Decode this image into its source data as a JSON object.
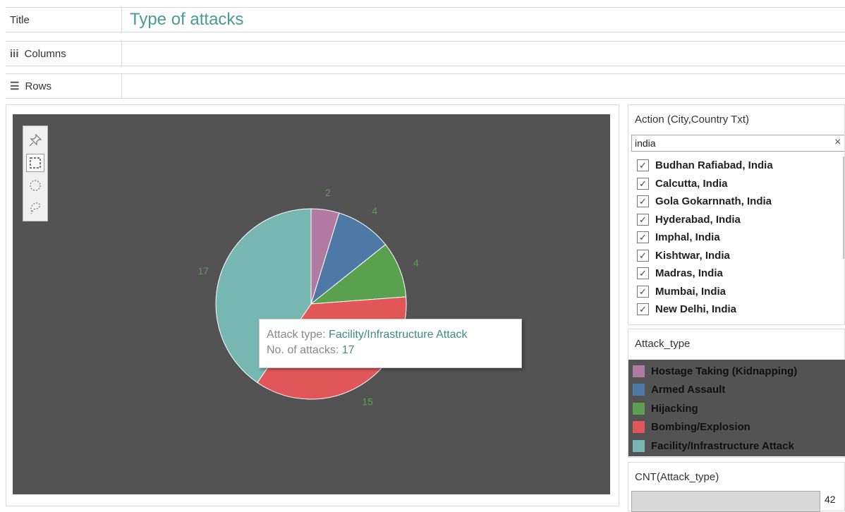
{
  "shelves": {
    "title_label": "Title",
    "title_value": "Type of attacks",
    "columns_label": "Columns",
    "rows_label": "Rows"
  },
  "tooltip": {
    "line1_label": "Attack type:",
    "line1_value": "Facility/Infrastructure Attack",
    "line2_label": "No. of attacks:",
    "line2_value": "17"
  },
  "action_filter": {
    "title": "Action (City,Country Txt)",
    "search_value": "india",
    "clear_symbol": "×",
    "items": [
      {
        "label": "Budhan Rafiabad, India",
        "checked": true
      },
      {
        "label": "Calcutta, India",
        "checked": true
      },
      {
        "label": "Gola Gokarnnath, India",
        "checked": true
      },
      {
        "label": "Hyderabad, India",
        "checked": true
      },
      {
        "label": "Imphal, India",
        "checked": true
      },
      {
        "label": "Kishtwar, India",
        "checked": true
      },
      {
        "label": "Madras, India",
        "checked": true
      },
      {
        "label": "Mumbai, India",
        "checked": true
      },
      {
        "label": "New Delhi, India",
        "checked": true
      }
    ]
  },
  "legend": {
    "title": "Attack_type",
    "items": [
      {
        "label": "Hostage Taking (Kidnapping)",
        "color": "#b07aa1"
      },
      {
        "label": "Armed Assault",
        "color": "#4e79a7"
      },
      {
        "label": "Hijacking",
        "color": "#59a14f"
      },
      {
        "label": "Bombing/Explosion",
        "color": "#e15759"
      },
      {
        "label": "Facility/Infrastructure Attack",
        "color": "#76b7b2"
      }
    ]
  },
  "cnt": {
    "title": "CNT(Attack_type)",
    "value": "42"
  },
  "toolbar_icons": [
    "pin-icon",
    "rectangle-select-icon",
    "radial-select-icon",
    "lasso-select-icon"
  ],
  "chart_data": {
    "type": "pie",
    "slices": [
      {
        "label": "Hostage Taking (Kidnapping)",
        "value": 2,
        "color": "#b07aa1"
      },
      {
        "label": "Armed Assault",
        "value": 4,
        "color": "#4e79a7"
      },
      {
        "label": "Hijacking",
        "value": 4,
        "color": "#59a14f"
      },
      {
        "label": "Bombing/Explosion",
        "value": 15,
        "color": "#e15759"
      },
      {
        "label": "Facility/Infrastructure Attack",
        "value": 17,
        "color": "#76b7b2"
      }
    ],
    "label_color": "#59a14f",
    "background": "#535353"
  }
}
